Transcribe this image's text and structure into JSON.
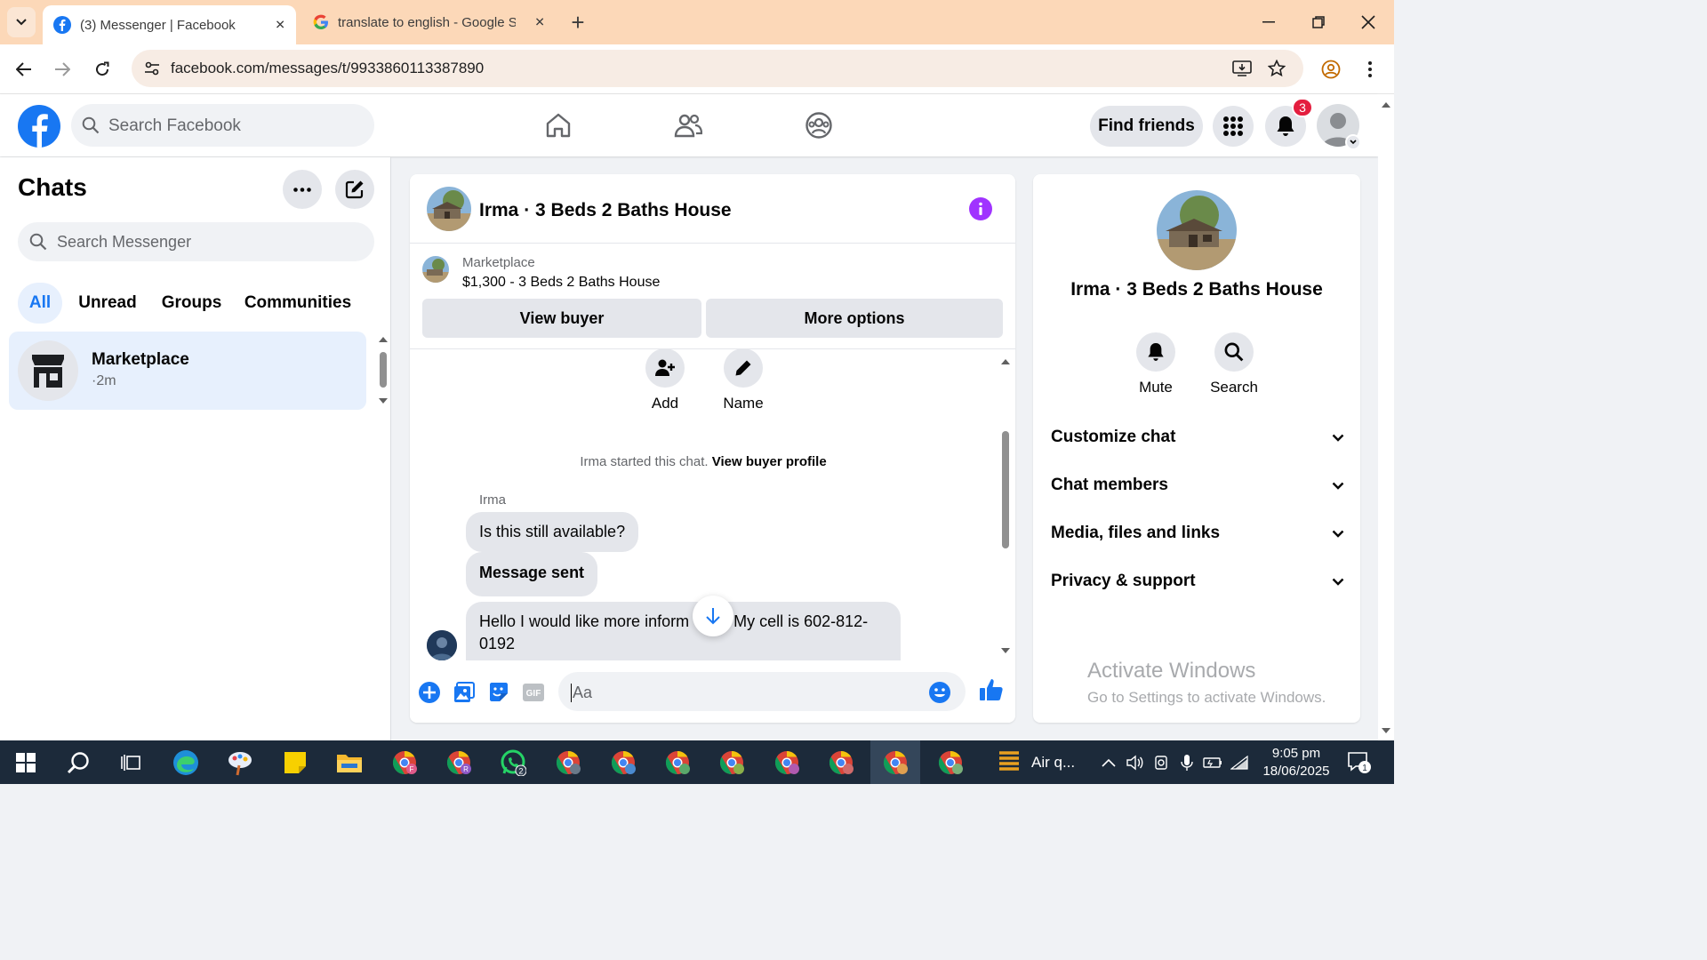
{
  "browser": {
    "tabs": [
      {
        "title": "(3) Messenger | Facebook",
        "icon": "facebook-icon",
        "active": true
      },
      {
        "title": "translate to english - Google Se",
        "icon": "google-icon",
        "active": false
      }
    ],
    "url": "facebook.com/messages/t/9933860113387890"
  },
  "header": {
    "search_placeholder": "Search Facebook",
    "find_friends": "Find friends",
    "notification_count": "3",
    "brand_color": "#1877f2"
  },
  "sidebar": {
    "title": "Chats",
    "search_placeholder": "Search Messenger",
    "filters": [
      "All",
      "Unread",
      "Groups",
      "Communities"
    ],
    "active_filter": "All",
    "chats": [
      {
        "name": "Marketplace",
        "time": "·2m"
      }
    ]
  },
  "conversation": {
    "title": "Irma · 3 Beds 2 Baths House",
    "marketplace_label": "Marketplace",
    "listing": "$1,300 - 3 Beds 2 Baths House",
    "view_buyer": "View buyer",
    "more_options": "More options",
    "actions": [
      {
        "label": "Add",
        "icon": "add-person-icon"
      },
      {
        "label": "Name",
        "icon": "pencil-icon"
      }
    ],
    "started_text": "Irma started this chat.",
    "view_buyer_profile": "View buyer profile",
    "sender": "Irma",
    "messages": [
      "Is this still available?",
      "Message sent",
      "Hello I would like more inform",
      ". My cell is 602-812-",
      "0192"
    ],
    "composer_placeholder": "Aa"
  },
  "details": {
    "title": "Irma · 3 Beds 2 Baths House",
    "actions": [
      "Mute",
      "Search"
    ],
    "sections": [
      "Customize chat",
      "Chat members",
      "Media, files and links",
      "Privacy & support"
    ],
    "watermark_title": "Activate Windows",
    "watermark_sub": "Go to Settings to activate Windows."
  },
  "taskbar": {
    "weather": "Air q...",
    "time": "9:05 pm",
    "date": "18/06/2025",
    "whatsapp_badge": "2",
    "notification_count": "1"
  }
}
